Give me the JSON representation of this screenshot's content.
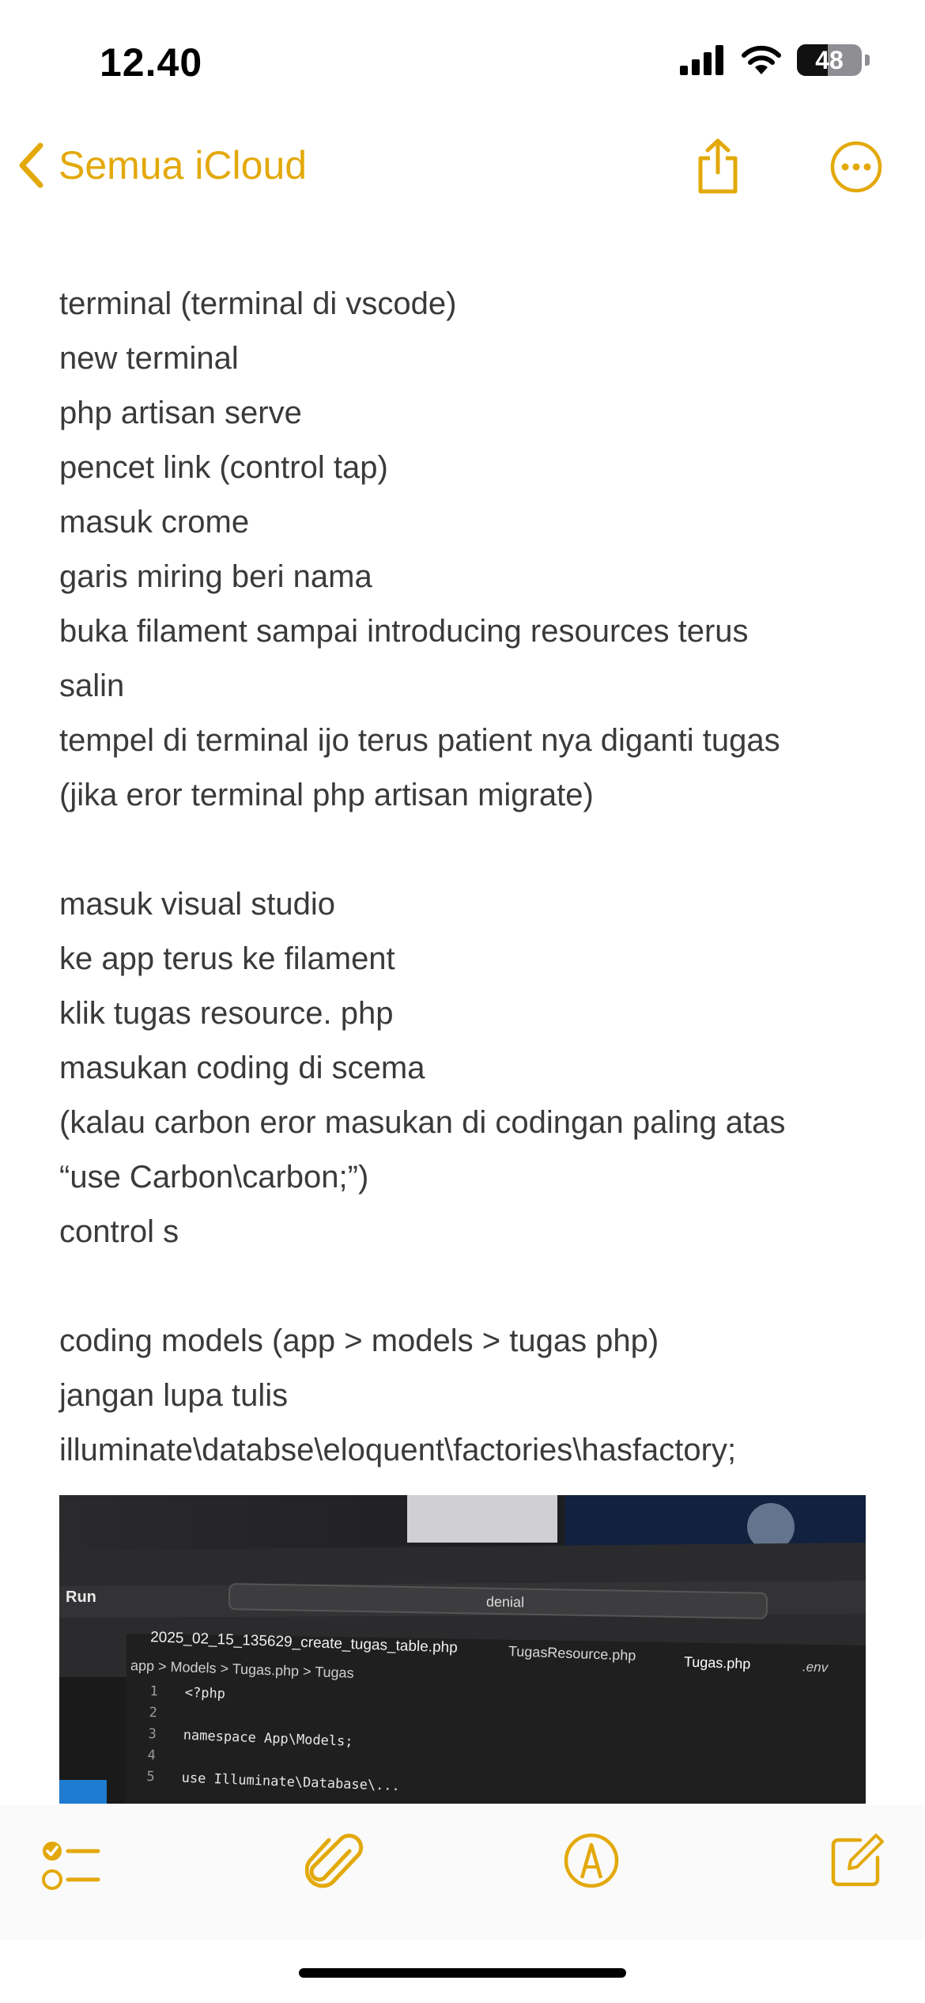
{
  "status_bar": {
    "time": "12.40",
    "battery_level": "48",
    "icons": [
      "cellular-signal-icon",
      "wifi-icon",
      "battery-icon"
    ]
  },
  "nav": {
    "back_label": "Semua iCloud",
    "icons": [
      "chevron-left-icon",
      "share-icon",
      "more-icon"
    ]
  },
  "note": {
    "lines": [
      "terminal (terminal di vscode)",
      "new terminal",
      "php artisan serve",
      "pencet link (control tap)",
      "masuk crome",
      "garis miring beri nama",
      "buka filament sampai introducing resources terus",
      "salin",
      "tempel di terminal ijo terus patient nya diganti tugas",
      "(jika eror terminal php artisan migrate)",
      "",
      "masuk visual studio",
      "ke app terus ke filament",
      "klik tugas resource. php",
      "masukan coding di scema",
      "(kalau carbon eror masukan di codingan paling atas",
      "“use Carbon\\carbon;”)",
      "control s",
      "",
      "coding models (app > models > tugas php)",
      "jangan lupa tulis",
      "illuminate\\databse\\eloquent\\factories\\hasfactory;"
    ]
  },
  "attachment": {
    "run_label": "Run",
    "search_text": "denial",
    "tabs": [
      "2025_02_15_135629_create_tugas_table.php",
      "TugasResource.php",
      "Tugas.php",
      ".env"
    ],
    "breadcrumb": "app > Models > Tugas.php > Tugas",
    "code_lines": [
      {
        "num": "1",
        "text": "<?php"
      },
      {
        "num": "2",
        "text": ""
      },
      {
        "num": "3",
        "text": "namespace App\\Models;"
      },
      {
        "num": "4",
        "text": ""
      },
      {
        "num": "5",
        "text": "use Illuminate\\Database\\..."
      }
    ]
  },
  "toolbar": {
    "icons": [
      "checklist-icon",
      "paperclip-icon",
      "markup-pen-icon",
      "compose-icon"
    ]
  },
  "colors": {
    "accent": "#e3a90b",
    "text": "#3a3a3c",
    "background": "#ffffff"
  }
}
